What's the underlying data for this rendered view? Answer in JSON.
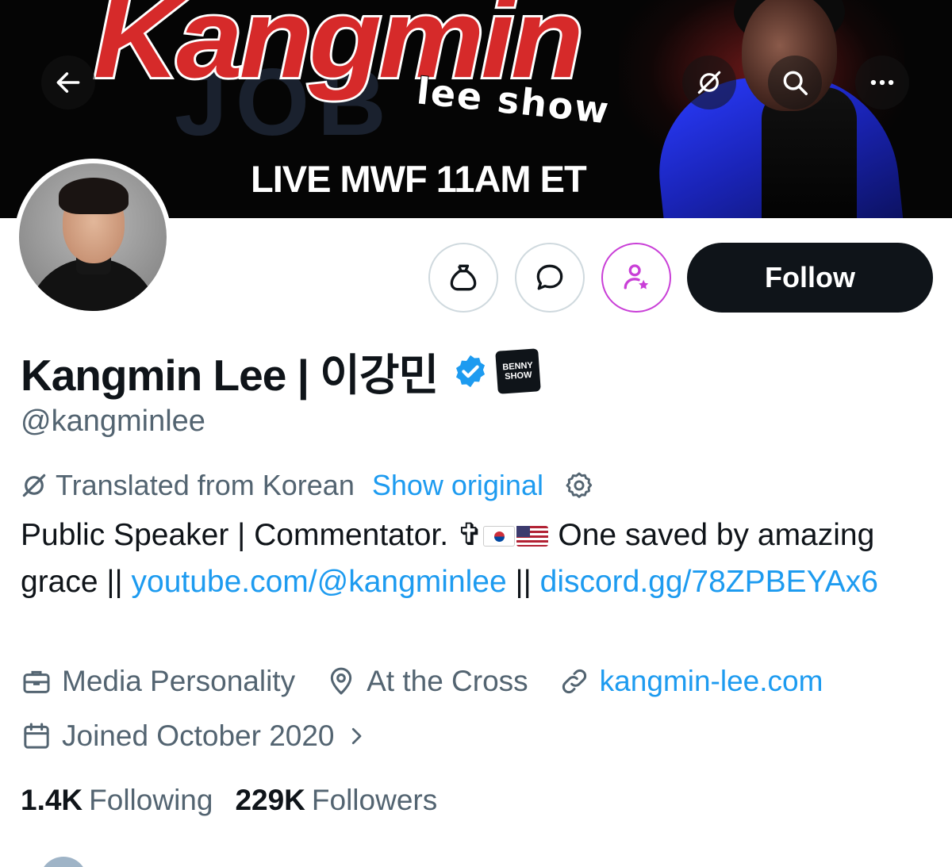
{
  "banner": {
    "title": "Kangmin",
    "subtitle": "lee show",
    "ghost": "JOB",
    "schedule": "LIVE MWF 11AM ET"
  },
  "nav": {
    "back_icon": "arrow-left-icon",
    "translate_icon": "translate-icon",
    "search_icon": "search-icon",
    "more_icon": "more-icon"
  },
  "actions": {
    "tip_icon": "money-bag-icon",
    "message_icon": "message-icon",
    "subscribe_icon": "subscribe-icon",
    "follow_label": "Follow"
  },
  "profile": {
    "name": "Kangmin Lee | 이강민",
    "verified": true,
    "affiliate_badge": "BENNY SHOW",
    "handle": "@kangminlee"
  },
  "bio": {
    "translated_label": "Translated from Korean",
    "show_original": "Show original",
    "text_part1": "Public Speaker | Commentator. ✞",
    "text_part2": " One saved by amazing grace || ",
    "link1": "youtube.com/@kangminlee",
    "separator": " || ",
    "link2": "discord.gg/78ZPBEYAx6"
  },
  "meta": {
    "category": "Media Personality",
    "location": "At the Cross",
    "website": "kangmin-lee.com",
    "joined": "Joined October 2020"
  },
  "stats": {
    "following_count": "1.4K",
    "following_label": "Following",
    "followers_count": "229K",
    "followers_label": "Followers"
  },
  "colors": {
    "link": "#1d9bf0",
    "text": "#0f1419",
    "muted": "#536471",
    "subscribe": "#c93fd7"
  }
}
